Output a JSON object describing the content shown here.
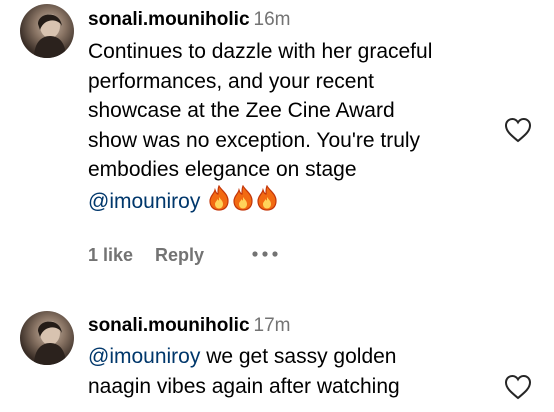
{
  "comments": [
    {
      "username": "sonali.mouniholic",
      "time": "16m",
      "text_lines": [
        "Continues to dazzle with her graceful",
        "performances, and your recent",
        "showcase at the Zee Cine Award",
        "show was no exception. You're truly",
        "embodies elegance on stage"
      ],
      "mention": "@imouniroy",
      "emoji": "🔥🔥🔥",
      "likes": "1 like",
      "reply": "Reply",
      "more_icon": "more-horizontal-icon",
      "like_icon": "heart-outline-icon"
    },
    {
      "username": "sonali.mouniholic",
      "time": "17m",
      "mention": "@imouniroy",
      "text_first": "we get sassy golden",
      "text_lines": [
        "naagin vibes again after watching"
      ],
      "like_icon": "heart-outline-icon"
    }
  ],
  "colors": {
    "text": "#000000",
    "muted": "#737373",
    "mention": "#00376b",
    "fire": "#f26a12"
  }
}
